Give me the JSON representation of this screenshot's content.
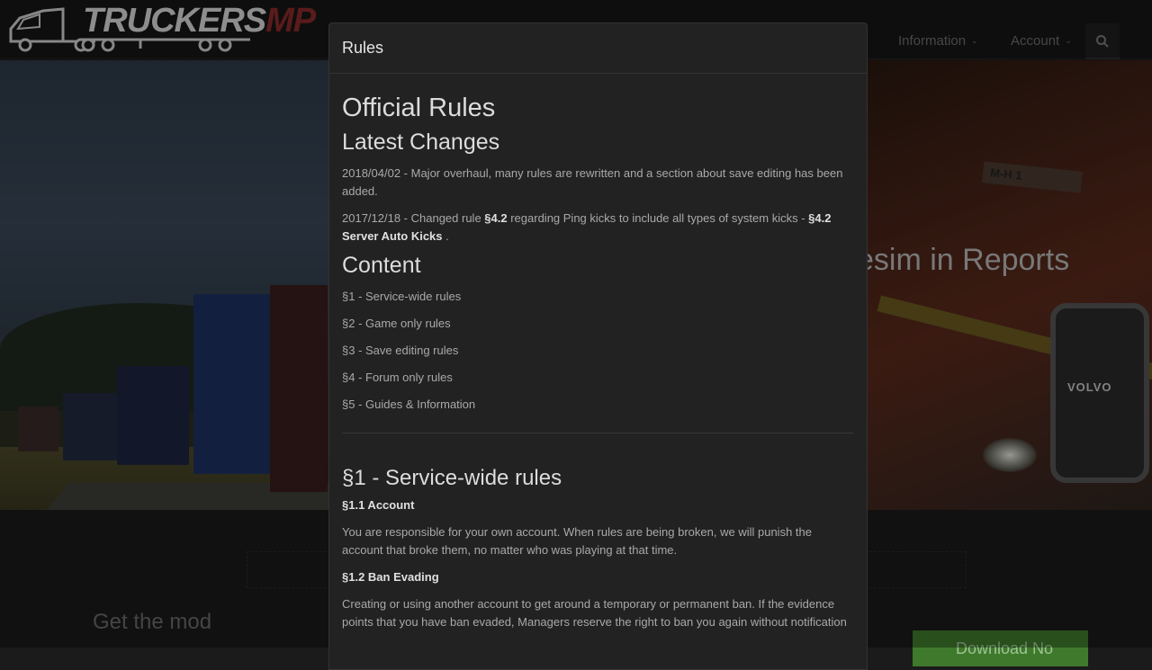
{
  "navbar": {
    "logo_text": "TRUCKERS",
    "logo_suffix": "MP",
    "items": [
      {
        "label": "Information"
      },
      {
        "label": "Account"
      }
    ]
  },
  "hero": {
    "title_fragment": "esim in Reports",
    "plate_text": "M-H 1",
    "brand_badge": "VOLVO"
  },
  "below": {
    "get_mod": "Get the mod",
    "download_label": "Download No"
  },
  "modal": {
    "title": "Rules",
    "heading": "Official Rules",
    "latest_changes": {
      "title": "Latest Changes",
      "entries": [
        {
          "text": "2018/04/02 - Major overhaul, many rules are rewritten and a section about save editing has been added."
        },
        {
          "prefix": "2017/12/18 - Changed rule ",
          "bold1": "§4.2",
          "middle": " regarding Ping kicks to include all types of system kicks - ",
          "bold2": "§4.2 Server Auto Kicks",
          "suffix": " ."
        }
      ]
    },
    "content": {
      "title": "Content",
      "items": [
        "§1 - Service-wide rules",
        "§2 - Game only rules",
        "§3 - Save editing rules",
        "§4 - Forum only rules",
        "§5 - Guides & Information"
      ]
    },
    "section1": {
      "title": "§1 - Service-wide rules",
      "rules": [
        {
          "title": "§1.1 Account",
          "text": "You are responsible for your own account. When rules are being broken, we will punish the account that broke them, no matter who was playing at that time."
        },
        {
          "title": "§1.2 Ban Evading",
          "text": "Creating or using another account to get around a temporary or permanent ban. If the evidence points that you have ban evaded, Managers reserve the right to ban you again without notification"
        }
      ]
    }
  }
}
